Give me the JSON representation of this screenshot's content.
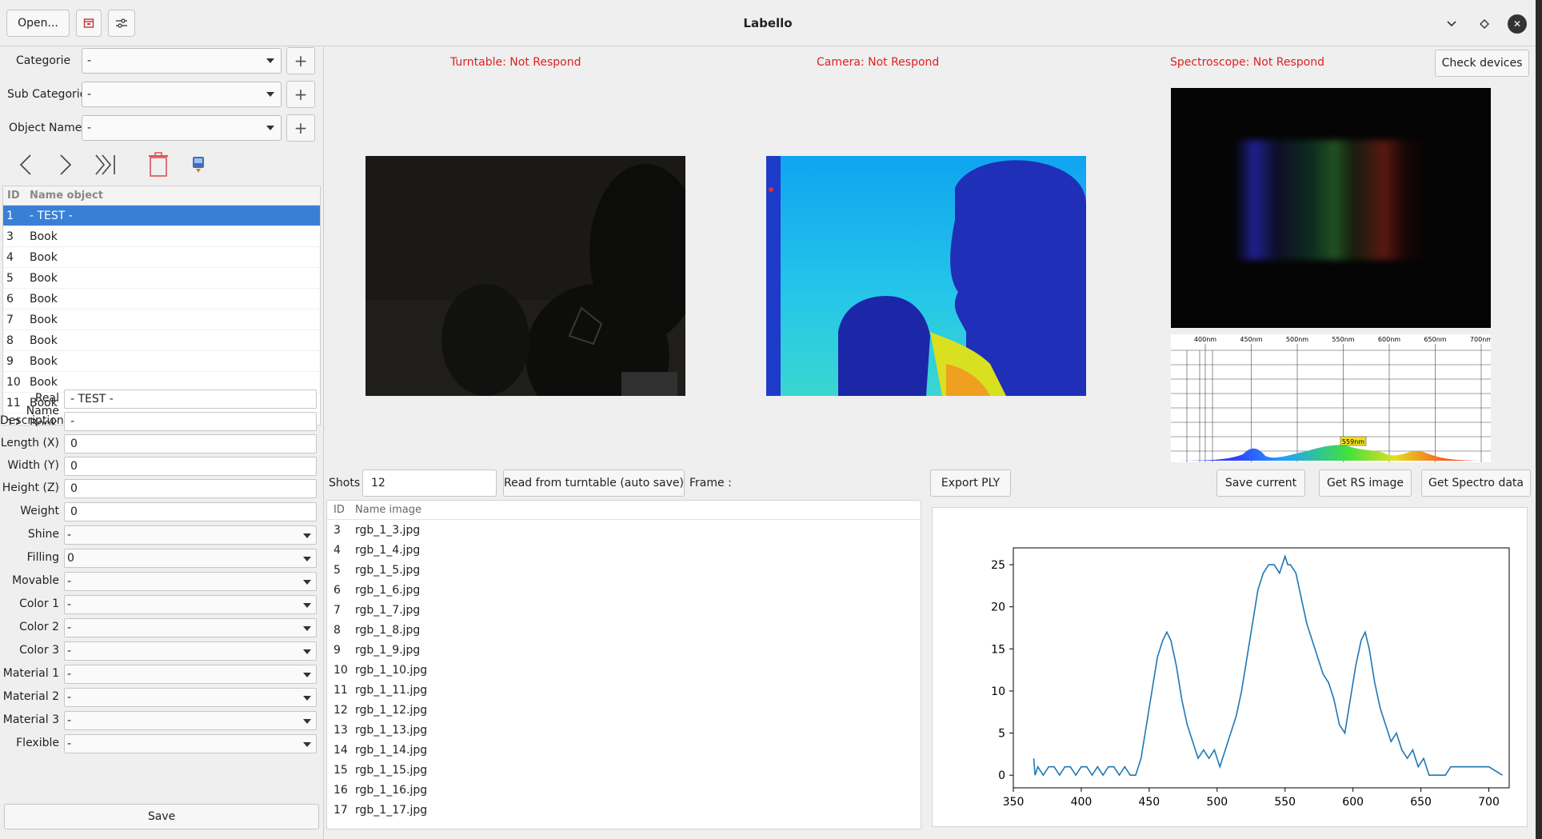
{
  "window": {
    "title": "Labello",
    "open_label": "Open...",
    "controls": [
      "chevron-down-icon",
      "diamond-icon",
      "close-icon"
    ]
  },
  "sidebar": {
    "categorie_label": "Categorie",
    "categorie_value": "-",
    "subcategorie_label": "Sub Categorie",
    "subcategorie_value": "-",
    "objectname_label": "Object Name",
    "objectname_value": "-",
    "table_headers": [
      "ID",
      "Name object"
    ],
    "objects": [
      {
        "id": "1",
        "name": "- TEST -",
        "selected": true
      },
      {
        "id": "3",
        "name": "Book"
      },
      {
        "id": "4",
        "name": "Book"
      },
      {
        "id": "5",
        "name": "Book"
      },
      {
        "id": "6",
        "name": "Book"
      },
      {
        "id": "7",
        "name": "Book"
      },
      {
        "id": "8",
        "name": "Book"
      },
      {
        "id": "9",
        "name": "Book"
      },
      {
        "id": "10",
        "name": "Book"
      },
      {
        "id": "11",
        "name": "Book"
      },
      {
        "id": "12",
        "name": "Book"
      }
    ],
    "fields": [
      {
        "label": "Real Name",
        "value": "- TEST -",
        "type": "text"
      },
      {
        "label": "Description",
        "value": "-",
        "type": "text"
      },
      {
        "label": "Length (X)",
        "value": "0",
        "type": "text"
      },
      {
        "label": "Width (Y)",
        "value": "0",
        "type": "text"
      },
      {
        "label": "Height (Z)",
        "value": "0",
        "type": "text"
      },
      {
        "label": "Weight",
        "value": "0",
        "type": "text"
      },
      {
        "label": "Shine",
        "value": "-",
        "type": "select"
      },
      {
        "label": "Filling",
        "value": "0",
        "type": "select"
      },
      {
        "label": "Movable",
        "value": "-",
        "type": "select"
      },
      {
        "label": "Color 1",
        "value": "-",
        "type": "select"
      },
      {
        "label": "Color 2",
        "value": "-",
        "type": "select"
      },
      {
        "label": "Color 3",
        "value": "-",
        "type": "select"
      },
      {
        "label": "Material 1",
        "value": "-",
        "type": "select"
      },
      {
        "label": "Material 2",
        "value": "-",
        "type": "select"
      },
      {
        "label": "Material 3",
        "value": "-",
        "type": "select"
      },
      {
        "label": "Flexible",
        "value": "-",
        "type": "select"
      }
    ],
    "save_label": "Save"
  },
  "status": {
    "turntable": "Turntable: Not Respond",
    "camera": "Camera: Not Respond",
    "spectroscope": "Spectroscope: Not Respond",
    "color": "#e02020"
  },
  "buttons": {
    "check_devices": "Check devices",
    "read_turntable": "Read from turntable (auto save)",
    "export_ply": "Export PLY",
    "save_current": "Save current",
    "get_rs_image": "Get RS image",
    "get_spectro": "Get Spectro data"
  },
  "shots": {
    "label": "Shots",
    "value": "12",
    "frame_label": "Frame :"
  },
  "spectro_scale": {
    "ticks": [
      "400nm",
      "450nm",
      "500nm",
      "550nm",
      "600nm",
      "650nm",
      "700nm"
    ],
    "marker": "559nm"
  },
  "images": {
    "headers": [
      "ID",
      "Name image"
    ],
    "rows": [
      {
        "id": "3",
        "name": "rgb_1_3.jpg"
      },
      {
        "id": "4",
        "name": "rgb_1_4.jpg"
      },
      {
        "id": "5",
        "name": "rgb_1_5.jpg"
      },
      {
        "id": "6",
        "name": "rgb_1_6.jpg"
      },
      {
        "id": "7",
        "name": "rgb_1_7.jpg"
      },
      {
        "id": "8",
        "name": "rgb_1_8.jpg"
      },
      {
        "id": "9",
        "name": "rgb_1_9.jpg"
      },
      {
        "id": "10",
        "name": "rgb_1_10.jpg"
      },
      {
        "id": "11",
        "name": "rgb_1_11.jpg"
      },
      {
        "id": "12",
        "name": "rgb_1_12.jpg"
      },
      {
        "id": "13",
        "name": "rgb_1_13.jpg"
      },
      {
        "id": "14",
        "name": "rgb_1_14.jpg"
      },
      {
        "id": "15",
        "name": "rgb_1_15.jpg"
      },
      {
        "id": "16",
        "name": "rgb_1_16.jpg"
      },
      {
        "id": "17",
        "name": "rgb_1_17.jpg"
      }
    ]
  },
  "chart_data": {
    "type": "line",
    "title": "",
    "xlabel": "",
    "ylabel": "",
    "xlim": [
      350,
      715
    ],
    "ylim": [
      -1.5,
      27
    ],
    "xticks": [
      350,
      400,
      450,
      500,
      550,
      600,
      650,
      700
    ],
    "yticks": [
      0,
      5,
      10,
      15,
      20,
      25
    ],
    "line_color": "#1f77b4",
    "x": [
      365,
      366,
      368,
      372,
      376,
      380,
      384,
      388,
      392,
      396,
      400,
      404,
      408,
      412,
      416,
      420,
      424,
      428,
      432,
      436,
      440,
      444,
      448,
      452,
      456,
      460,
      463,
      466,
      470,
      474,
      478,
      482,
      486,
      490,
      494,
      498,
      502,
      506,
      510,
      514,
      518,
      522,
      526,
      530,
      534,
      538,
      542,
      546,
      550,
      552,
      554,
      558,
      562,
      566,
      570,
      574,
      578,
      582,
      586,
      590,
      594,
      598,
      602,
      606,
      609,
      612,
      616,
      620,
      624,
      628,
      632,
      636,
      640,
      644,
      648,
      652,
      656,
      660,
      664,
      668,
      672,
      676,
      680,
      690,
      700,
      710
    ],
    "y": [
      2,
      0,
      1,
      0,
      1,
      1,
      0,
      1,
      1,
      0,
      1,
      1,
      0,
      1,
      0,
      1,
      1,
      0,
      1,
      0,
      0,
      2,
      6,
      10,
      14,
      16,
      17,
      16,
      13,
      9,
      6,
      4,
      2,
      3,
      2,
      3,
      1,
      3,
      5,
      7,
      10,
      14,
      18,
      22,
      24,
      25,
      25,
      24,
      26,
      25,
      25,
      24,
      21,
      18,
      16,
      14,
      12,
      11,
      9,
      6,
      5,
      9,
      13,
      16,
      17,
      15,
      11,
      8,
      6,
      4,
      5,
      3,
      2,
      3,
      1,
      2,
      0,
      0,
      0,
      0,
      1,
      1,
      1,
      1,
      1,
      0
    ]
  }
}
